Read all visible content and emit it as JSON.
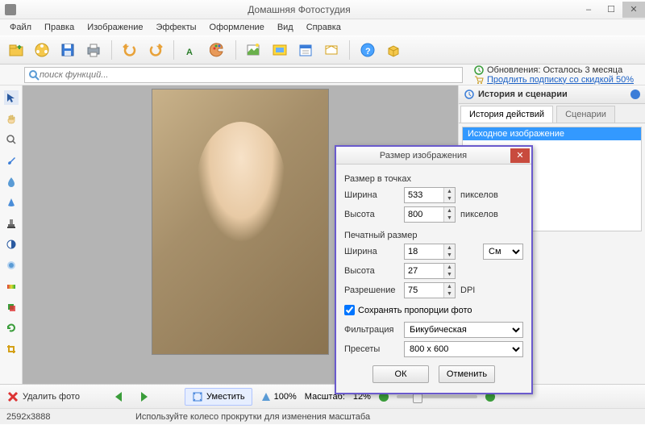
{
  "title": "Домашняя Фотостудия",
  "menu": [
    "Файл",
    "Правка",
    "Изображение",
    "Эффекты",
    "Оформление",
    "Вид",
    "Справка"
  ],
  "search": {
    "placeholder": "поиск функций..."
  },
  "updates": {
    "line1": "Обновления: Осталось  3 месяца",
    "line2": "Продлить подписку со скидкой 50%"
  },
  "history": {
    "panel_title": "История и сценарии",
    "tab_history": "История действий",
    "tab_scenarios": "Сценарии",
    "item": "Исходное изображение"
  },
  "bottom": {
    "delete": "Удалить фото",
    "fit": "Уместить",
    "zoom100": "100%",
    "scale_label": "Масштаб:",
    "scale_value": "12%"
  },
  "status": {
    "dim": "2592x3888",
    "hint": "Используйте колесо прокрутки для изменения масштаба"
  },
  "dialog": {
    "title": "Размер изображения",
    "pixels_section": "Размер в точках",
    "width_label": "Ширина",
    "height_label": "Высота",
    "width_px": "533",
    "height_px": "800",
    "px_unit": "пикселов",
    "print_section": "Печатный размер",
    "print_w": "18",
    "print_h": "27",
    "unit_combo": "См",
    "res_label": "Разрешение",
    "res_val": "75",
    "dpi": "DPI",
    "keep_ratio": "Сохранять пропорции фото",
    "filter_label": "Фильтрация",
    "filter_val": "Бикубическая",
    "preset_label": "Пресеты",
    "preset_val": "800 x 600",
    "ok": "ОК",
    "cancel": "Отменить"
  }
}
